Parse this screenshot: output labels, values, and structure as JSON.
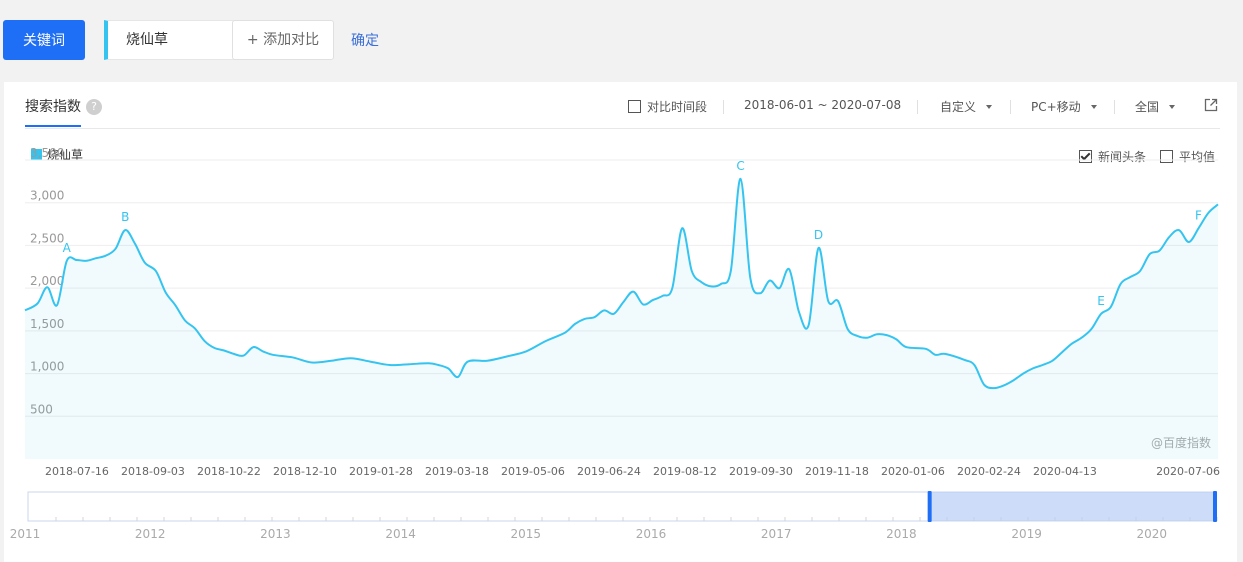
{
  "toolbar": {
    "keyword_button": "关键词",
    "keyword_value": "烧仙草",
    "add_compare": "+ 添加对比",
    "confirm": "确定"
  },
  "panel": {
    "tab": "搜索指数",
    "help": "?",
    "compare_period": "对比时间段",
    "date_range": "2018-06-01 ~ 2020-07-08",
    "custom": "自定义",
    "device": "PC+移动",
    "region": "全国",
    "legend": "烧仙草",
    "news_option": "新闻头条",
    "avg_option": "平均值",
    "watermark": "@百度指数"
  },
  "colors": {
    "accent": "#1f6ff6",
    "series": "#35c4ef",
    "link": "#3a6fd8"
  },
  "icons": {
    "external": "external-link-icon",
    "help": "question-icon"
  },
  "chart_data": {
    "type": "area",
    "series": [
      {
        "name": "烧仙草",
        "points": [
          [
            "2018-06-01",
            1740
          ],
          [
            "2018-06-10",
            1820
          ],
          [
            "2018-06-17",
            2010
          ],
          [
            "2018-06-24",
            1800
          ],
          [
            "2018-07-01",
            2320
          ],
          [
            "2018-07-08",
            2330
          ],
          [
            "2018-07-15",
            2320
          ],
          [
            "2018-07-22",
            2350
          ],
          [
            "2018-07-29",
            2380
          ],
          [
            "2018-08-05",
            2460
          ],
          [
            "2018-08-12",
            2680
          ],
          [
            "2018-08-19",
            2520
          ],
          [
            "2018-08-26",
            2300
          ],
          [
            "2018-09-03",
            2200
          ],
          [
            "2018-09-10",
            1950
          ],
          [
            "2018-09-17",
            1800
          ],
          [
            "2018-09-24",
            1620
          ],
          [
            "2018-10-01",
            1530
          ],
          [
            "2018-10-08",
            1380
          ],
          [
            "2018-10-15",
            1300
          ],
          [
            "2018-10-22",
            1270
          ],
          [
            "2018-10-29",
            1230
          ],
          [
            "2018-11-05",
            1210
          ],
          [
            "2018-11-12",
            1310
          ],
          [
            "2018-11-19",
            1260
          ],
          [
            "2018-11-26",
            1220
          ],
          [
            "2018-12-10",
            1190
          ],
          [
            "2018-12-24",
            1130
          ],
          [
            "2019-01-07",
            1150
          ],
          [
            "2019-01-21",
            1180
          ],
          [
            "2019-02-04",
            1140
          ],
          [
            "2019-02-18",
            1100
          ],
          [
            "2019-03-04",
            1110
          ],
          [
            "2019-03-18",
            1120
          ],
          [
            "2019-03-25",
            1100
          ],
          [
            "2019-04-01",
            1060
          ],
          [
            "2019-04-08",
            960
          ],
          [
            "2019-04-15",
            1140
          ],
          [
            "2019-04-29",
            1150
          ],
          [
            "2019-05-13",
            1200
          ],
          [
            "2019-05-27",
            1260
          ],
          [
            "2019-06-10",
            1380
          ],
          [
            "2019-06-24",
            1480
          ],
          [
            "2019-07-01",
            1580
          ],
          [
            "2019-07-08",
            1640
          ],
          [
            "2019-07-15",
            1660
          ],
          [
            "2019-07-22",
            1740
          ],
          [
            "2019-07-29",
            1700
          ],
          [
            "2019-08-05",
            1840
          ],
          [
            "2019-08-12",
            1960
          ],
          [
            "2019-08-19",
            1810
          ],
          [
            "2019-08-26",
            1860
          ],
          [
            "2019-09-02",
            1910
          ],
          [
            "2019-09-09",
            2000
          ],
          [
            "2019-09-16",
            2700
          ],
          [
            "2019-09-23",
            2200
          ],
          [
            "2019-09-30",
            2070
          ],
          [
            "2019-10-07",
            2020
          ],
          [
            "2019-10-14",
            2050
          ],
          [
            "2019-10-21",
            2200
          ],
          [
            "2019-10-28",
            3280
          ],
          [
            "2019-11-04",
            2120
          ],
          [
            "2019-11-11",
            1940
          ],
          [
            "2019-11-18",
            2090
          ],
          [
            "2019-11-25",
            2000
          ],
          [
            "2019-12-02",
            2220
          ],
          [
            "2019-12-09",
            1720
          ],
          [
            "2019-12-16",
            1570
          ],
          [
            "2019-12-23",
            2470
          ],
          [
            "2019-12-30",
            1850
          ],
          [
            "2020-01-06",
            1850
          ],
          [
            "2020-01-13",
            1520
          ],
          [
            "2020-01-20",
            1440
          ],
          [
            "2020-01-27",
            1420
          ],
          [
            "2020-02-03",
            1460
          ],
          [
            "2020-02-10",
            1450
          ],
          [
            "2020-02-17",
            1400
          ],
          [
            "2020-02-24",
            1310
          ],
          [
            "2020-03-09",
            1290
          ],
          [
            "2020-03-16",
            1220
          ],
          [
            "2020-03-23",
            1230
          ],
          [
            "2020-04-06",
            1160
          ],
          [
            "2020-04-13",
            1100
          ],
          [
            "2020-04-20",
            870
          ],
          [
            "2020-04-27",
            830
          ],
          [
            "2020-05-04",
            860
          ],
          [
            "2020-05-11",
            920
          ],
          [
            "2020-05-18",
            1000
          ],
          [
            "2020-05-25",
            1060
          ],
          [
            "2020-06-01",
            1100
          ],
          [
            "2020-06-08",
            1150
          ],
          [
            "2020-06-15",
            1250
          ],
          [
            "2020-06-22",
            1350
          ],
          [
            "2020-06-29",
            1420
          ],
          [
            "2020-07-06",
            1520
          ],
          [
            "2020-07-13",
            1700
          ],
          [
            "2020-07-20",
            1780
          ],
          [
            "2020-07-27",
            2050
          ],
          [
            "2020-08-03",
            2130
          ],
          [
            "2020-08-10",
            2200
          ],
          [
            "2020-08-17",
            2400
          ],
          [
            "2020-08-24",
            2440
          ],
          [
            "2020-08-31",
            2600
          ],
          [
            "2020-09-07",
            2680
          ],
          [
            "2020-09-14",
            2540
          ],
          [
            "2020-09-21",
            2700
          ],
          [
            "2020-09-28",
            2880
          ],
          [
            "2020-10-05",
            2980
          ]
        ]
      }
    ],
    "ylim": [
      0,
      3500
    ],
    "yticks": [
      "3,500",
      "3,000",
      "2,500",
      "2,000",
      "1,500",
      "1,000",
      "500"
    ],
    "ytick_values": [
      3500,
      3000,
      2500,
      2000,
      1500,
      1000,
      500
    ],
    "xticks": [
      "2018-07-16",
      "2018-09-03",
      "2018-10-22",
      "2018-12-10",
      "2019-01-28",
      "2019-03-18",
      "2019-05-06",
      "2019-06-24",
      "2019-08-12",
      "2019-09-30",
      "2019-11-18",
      "2020-01-06",
      "2020-02-24",
      "2020-04-13",
      "2020-07-06"
    ],
    "annotations": [
      {
        "label": "A",
        "x": "2018-07-01",
        "y": 2320
      },
      {
        "label": "B",
        "x": "2018-08-12",
        "y": 2680
      },
      {
        "label": "C",
        "x": "2019-10-28",
        "y": 3280
      },
      {
        "label": "D",
        "x": "2019-12-23",
        "y": 2470
      },
      {
        "label": "E",
        "x": "2020-07-13",
        "y": 1700
      },
      {
        "label": "F",
        "x": "2020-09-21",
        "y": 2700
      }
    ],
    "grid": true,
    "navigator": {
      "years": [
        "2011",
        "2012",
        "2013",
        "2014",
        "2015",
        "2016",
        "2017",
        "2018",
        "2019",
        "2020"
      ],
      "range": [
        "2011-01-01",
        "2020-10-08"
      ],
      "selection": [
        "2018-06-01",
        "2020-10-05"
      ]
    }
  }
}
